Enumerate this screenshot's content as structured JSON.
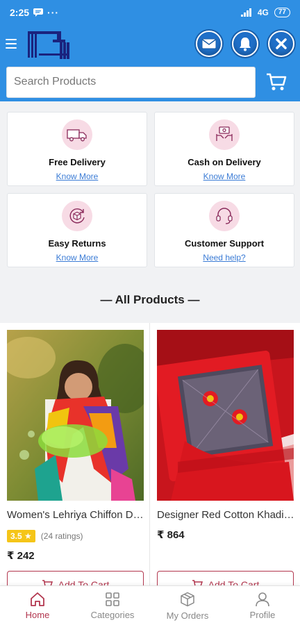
{
  "status_bar": {
    "time": "2:25",
    "network": "4G",
    "battery": "77"
  },
  "app_bar": {
    "actions": [
      "mail-icon",
      "bell-icon",
      "close-icon"
    ]
  },
  "search": {
    "placeholder": "Search Products"
  },
  "features": [
    {
      "title": "Free Delivery",
      "link": "Know More",
      "icon": "truck-icon"
    },
    {
      "title": "Cash on Delivery",
      "link": "Know More",
      "icon": "cash-hand-icon"
    },
    {
      "title": "Easy Returns",
      "link": "Know More",
      "icon": "return-box-icon"
    },
    {
      "title": "Customer Support",
      "link": "Need help?",
      "icon": "headset-icon"
    }
  ],
  "section": {
    "title": "— All Products —"
  },
  "products": [
    {
      "name": "Women's Lehriya Chiffon Dupatta",
      "rating": "3.5",
      "ratings_count": "(24 ratings)",
      "price": "₹ 242",
      "button": "Add To Cart"
    },
    {
      "name": "Designer Red Cotton Khadi Suit",
      "price": "₹ 864",
      "button": "Add To Cart"
    }
  ],
  "bottom_nav": [
    {
      "label": "Home",
      "icon": "home-icon",
      "active": true
    },
    {
      "label": "Categories",
      "icon": "grid-icon",
      "active": false
    },
    {
      "label": "My Orders",
      "icon": "box-icon",
      "active": false
    },
    {
      "label": "Profile",
      "icon": "user-icon",
      "active": false
    }
  ],
  "colors": {
    "primary": "#2f8fe3",
    "accent": "#b2364e",
    "link": "#3a7bd5",
    "rating": "#f5c518"
  }
}
